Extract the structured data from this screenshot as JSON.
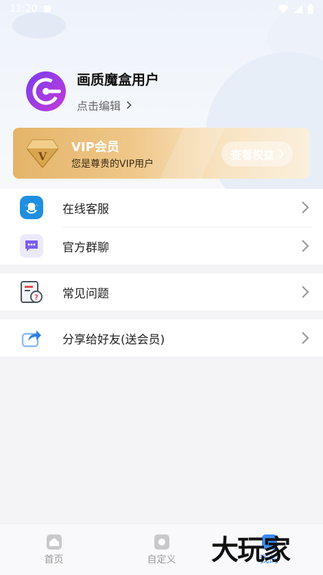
{
  "status_bar": {
    "time": "11:20"
  },
  "profile": {
    "name": "画质魔盒用户",
    "edit_label": "点击编辑"
  },
  "vip": {
    "title": "VIP会员",
    "subtitle": "您是尊贵的VIP用户",
    "button_label": "查看权益",
    "badge_letter": "V"
  },
  "menu": {
    "group1": [
      {
        "label": "在线客服",
        "icon": "customer-service-icon"
      },
      {
        "label": "官方群聊",
        "icon": "group-chat-icon"
      }
    ],
    "group2": [
      {
        "label": "常见问题",
        "icon": "faq-icon"
      }
    ],
    "group3": [
      {
        "label": "分享给好友(送会员)",
        "icon": "share-icon"
      }
    ]
  },
  "nav": {
    "home": "首页",
    "custom": "自定义",
    "mine": "我的"
  },
  "watermark": "大玩家",
  "colors": {
    "accent": "#3a8cf5",
    "vip_gold": "#e4b469",
    "avatar_purple": "#7b3df0"
  }
}
